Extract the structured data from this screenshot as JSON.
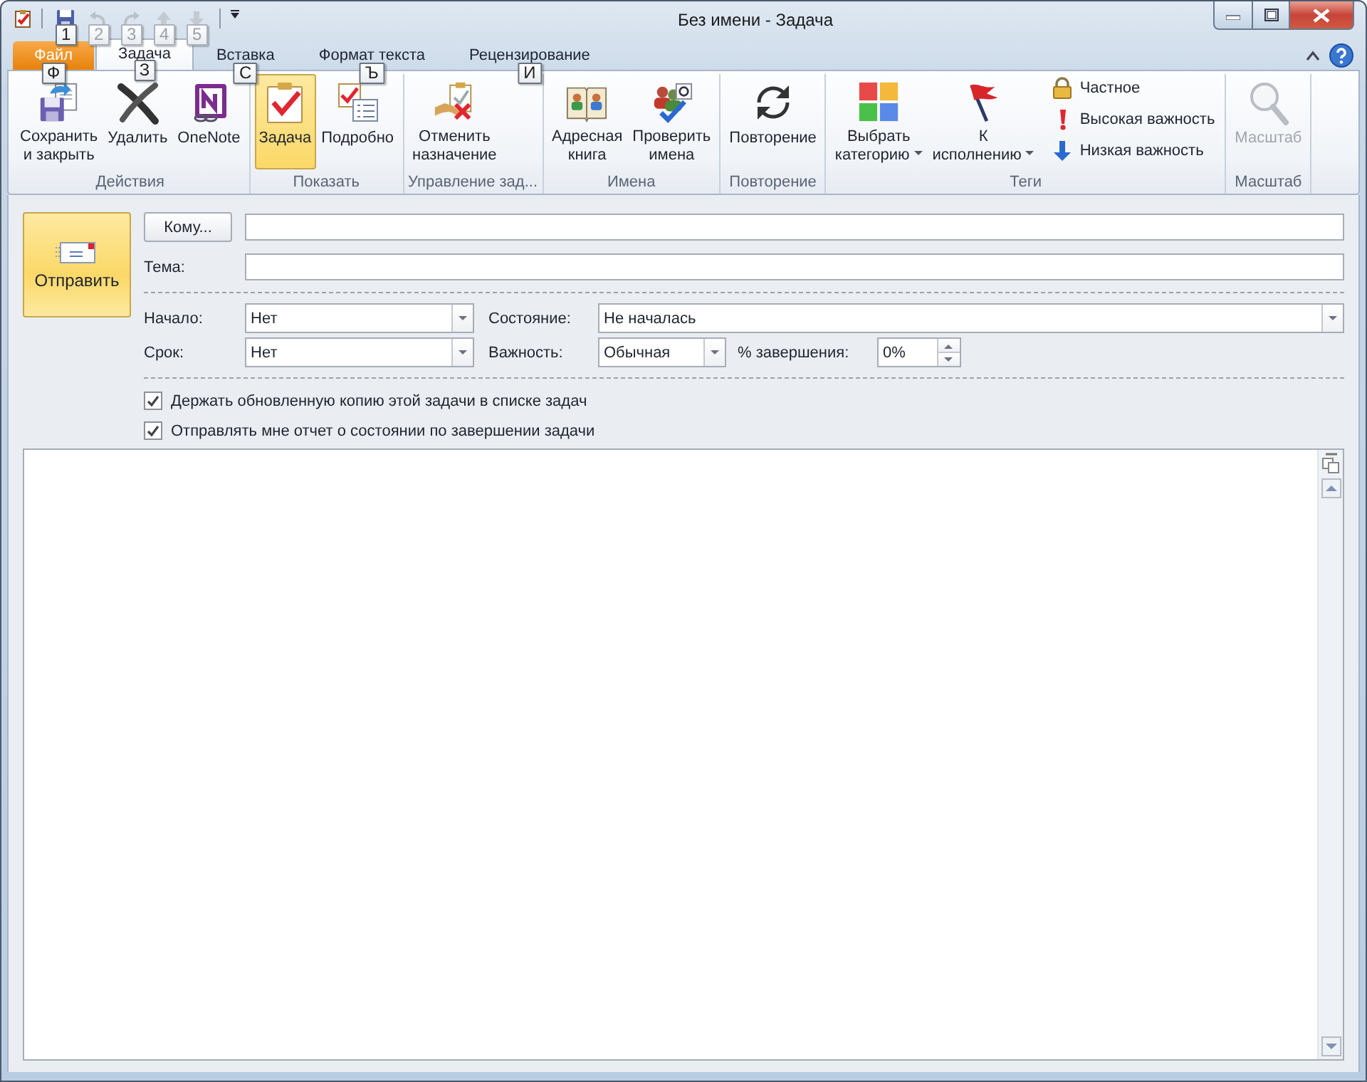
{
  "window": {
    "title": "Без имени - Задача"
  },
  "quick_access": [
    {
      "keytip": "1",
      "disabled": false
    },
    {
      "keytip": "2",
      "disabled": true
    },
    {
      "keytip": "3",
      "disabled": true
    },
    {
      "keytip": "4",
      "disabled": true
    },
    {
      "keytip": "5",
      "disabled": true
    }
  ],
  "tabs": [
    {
      "label": "Файл",
      "kind": "file",
      "keytip": "Ф",
      "selected": false
    },
    {
      "label": "Задача",
      "kind": "tab",
      "keytip": "З",
      "selected": true
    },
    {
      "label": "Вставка",
      "kind": "tab",
      "keytip": "С",
      "selected": false
    },
    {
      "label": "Формат текста",
      "kind": "tab",
      "keytip": "Ъ",
      "selected": false
    },
    {
      "label": "Рецензирование",
      "kind": "tab",
      "keytip": "И",
      "selected": false
    }
  ],
  "ribbon": {
    "groups": [
      {
        "label": "Действия",
        "buttons": [
          {
            "kind": "large",
            "label": "Сохранить\nи закрыть",
            "disabled": false
          },
          {
            "kind": "large",
            "label": "Удалить",
            "disabled": false
          },
          {
            "kind": "large",
            "label": "OneNote",
            "disabled": false
          }
        ]
      },
      {
        "label": "Показать",
        "buttons": [
          {
            "kind": "large",
            "label": "Задача",
            "disabled": false,
            "selected": true
          },
          {
            "kind": "large",
            "label": "Подробно",
            "disabled": false,
            "selected": false
          }
        ]
      },
      {
        "label": "Управление зад...",
        "buttons": [
          {
            "kind": "large",
            "label": "Отменить\nназначение",
            "disabled": false
          }
        ]
      },
      {
        "label": "Имена",
        "buttons": [
          {
            "kind": "large",
            "label": "Адресная\nкнига",
            "disabled": false
          },
          {
            "kind": "large",
            "label": "Проверить\nимена",
            "disabled": false
          }
        ]
      },
      {
        "label": "Повторение",
        "buttons": [
          {
            "kind": "large",
            "label": "Повторение",
            "disabled": false
          }
        ]
      },
      {
        "label": "Теги",
        "buttons": [
          {
            "kind": "dropdown",
            "label": "Выбрать\nкатегорию",
            "disabled": false
          },
          {
            "kind": "dropdown",
            "label": "К\nисполнению",
            "disabled": false
          },
          {
            "kind": "small",
            "label": "Частное",
            "disabled": false
          },
          {
            "kind": "small",
            "label": "Высокая важность",
            "disabled": false
          },
          {
            "kind": "small",
            "label": "Низкая важность",
            "disabled": false
          }
        ]
      },
      {
        "label": "Масштаб",
        "buttons": [
          {
            "kind": "large",
            "label": "Масштаб",
            "disabled": true
          }
        ]
      }
    ]
  },
  "form": {
    "send_button": {
      "label": "Отправить"
    },
    "to": {
      "button": "Кому..."
    },
    "subject": {
      "label": "Тема:"
    },
    "rows": [
      [
        {
          "kind": "combo",
          "label": "Начало:",
          "value": "Нет"
        },
        {
          "kind": "combo",
          "label": "Состояние:",
          "value": "Не началась"
        }
      ],
      [
        {
          "kind": "combo",
          "label": "Срок:",
          "value": "Нет"
        },
        {
          "kind": "combo",
          "label": "Важность:",
          "value": "Обычная"
        },
        {
          "kind": "spin",
          "label": "% завершения:",
          "value": "0%"
        }
      ]
    ],
    "checks": [
      {
        "label": "Держать обновленную копию этой задачи в списке задач",
        "checked": true
      },
      {
        "label": "Отправлять мне отчет о состоянии по завершении задачи",
        "checked": true
      }
    ]
  }
}
